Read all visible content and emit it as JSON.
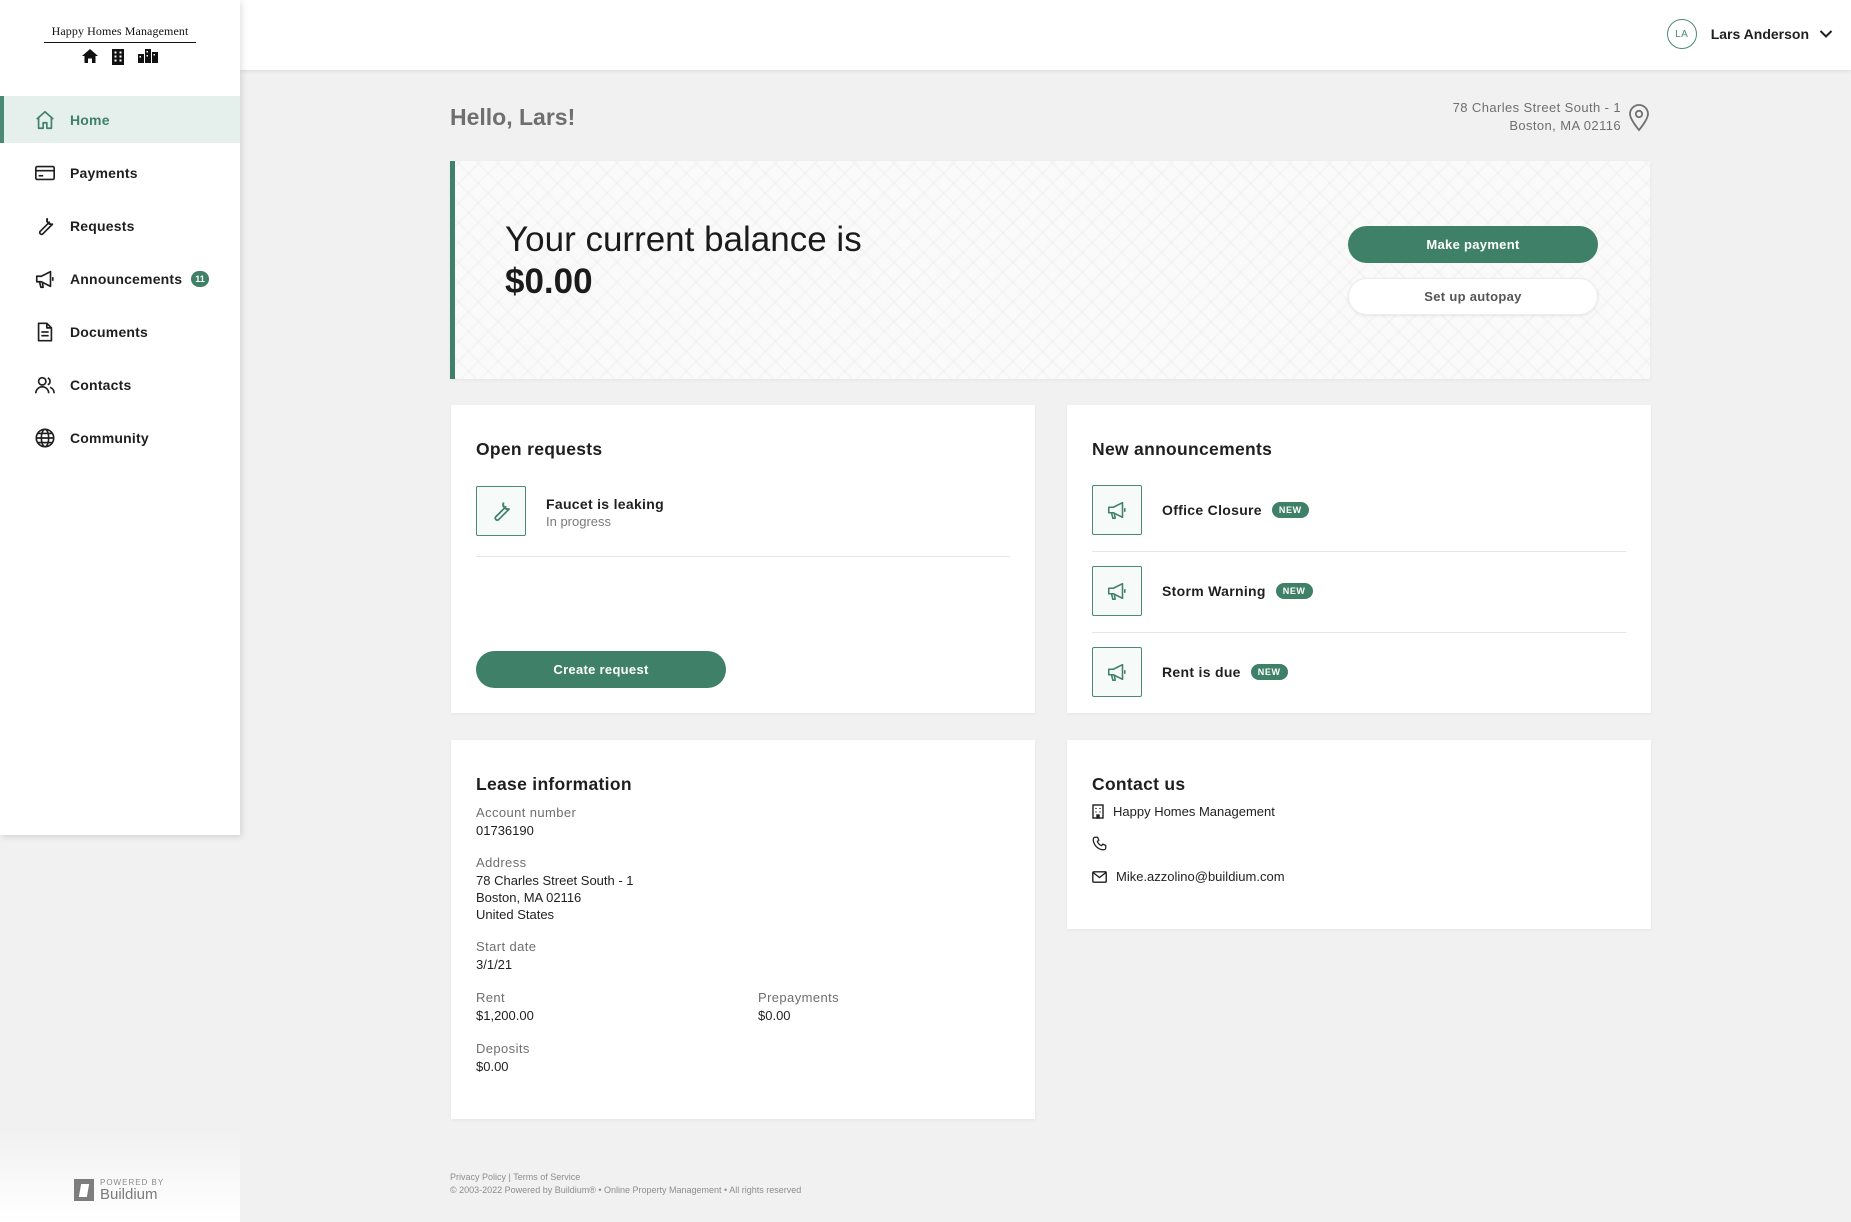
{
  "brand": {
    "name": "Happy Homes Management",
    "accent": "#3f8068",
    "icons": [
      "house-icon",
      "building-icon",
      "city-buildings-icon"
    ]
  },
  "sidebar": {
    "items": [
      {
        "label": "Home",
        "icon": "home-icon",
        "active": true
      },
      {
        "label": "Payments",
        "icon": "credit-card-icon"
      },
      {
        "label": "Requests",
        "icon": "wrench-icon"
      },
      {
        "label": "Announcements",
        "icon": "megaphone-icon",
        "badge": "11"
      },
      {
        "label": "Documents",
        "icon": "document-icon"
      },
      {
        "label": "Contacts",
        "icon": "people-icon"
      },
      {
        "label": "Community",
        "icon": "globe-icon"
      }
    ],
    "powered_by": {
      "small": "POWERED BY",
      "name": "Buildium"
    }
  },
  "header": {
    "user_initials": "LA",
    "user_name": "Lars Anderson"
  },
  "main": {
    "greeting": "Hello, Lars!",
    "address_line1": "78 Charles Street South - 1",
    "address_line2": "Boston, MA 02116",
    "balance": {
      "title": "Your current balance is",
      "amount": "$0.00",
      "make_payment": "Make payment",
      "autopay": "Set up autopay"
    },
    "open_requests": {
      "title": "Open requests",
      "items": [
        {
          "title": "Faucet is leaking",
          "status": "In progress"
        }
      ],
      "create_label": "Create request"
    },
    "announcements": {
      "title": "New announcements",
      "items": [
        {
          "title": "Office Closure",
          "badge": "NEW"
        },
        {
          "title": "Storm Warning",
          "badge": "NEW"
        },
        {
          "title": "Rent is due",
          "badge": "NEW"
        }
      ]
    },
    "lease": {
      "title": "Lease information",
      "account_label": "Account number",
      "account_value": "01736190",
      "address_label": "Address",
      "address_line1": "78 Charles Street South - 1",
      "address_line2": "Boston, MA 02116",
      "address_line3": "United States",
      "start_label": "Start date",
      "start_value": "3/1/21",
      "rent_label": "Rent",
      "rent_value": "$1,200.00",
      "prepay_label": "Prepayments",
      "prepay_value": "$0.00",
      "deposits_label": "Deposits",
      "deposits_value": "$0.00"
    },
    "contact": {
      "title": "Contact us",
      "company": "Happy Homes Management",
      "phone": "",
      "email": "Mike.azzolino@buildium.com"
    }
  },
  "footer": {
    "privacy": "Privacy Policy",
    "separator": "|",
    "terms": "Terms of Service",
    "copyright": "© 2003-2022 Powered by Buildium® • Online Property Management • All rights reserved"
  }
}
